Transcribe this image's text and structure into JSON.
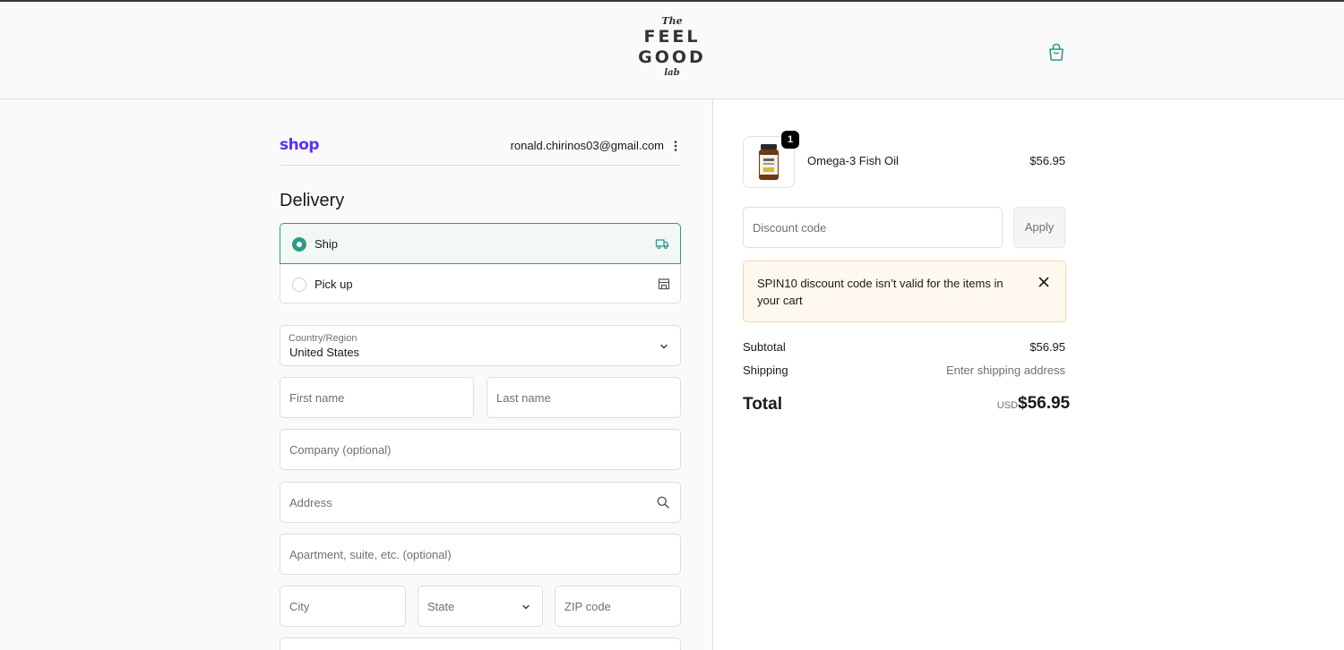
{
  "header": {
    "logo_the": "The",
    "logo_line1": "FEEL",
    "logo_line2": "GOOD",
    "logo_lab": "lab",
    "accent_color": "#2d9b87"
  },
  "account": {
    "shop_brand": "shop",
    "email": "ronald.chirinos03@gmail.com"
  },
  "delivery": {
    "title": "Delivery",
    "options": [
      {
        "label": "Ship",
        "selected": true,
        "icon": "truck-icon"
      },
      {
        "label": "Pick up",
        "selected": false,
        "icon": "store-icon"
      }
    ]
  },
  "form": {
    "country_label": "Country/Region",
    "country_value": "United States",
    "first_name_placeholder": "First name",
    "last_name_placeholder": "Last name",
    "company_placeholder": "Company (optional)",
    "address_placeholder": "Address",
    "apartment_placeholder": "Apartment, suite, etc. (optional)",
    "city_placeholder": "City",
    "state_placeholder": "State",
    "zip_placeholder": "ZIP code"
  },
  "cart": {
    "items": [
      {
        "name": "Omega-3 Fish Oil",
        "price": "$56.95",
        "quantity": "1"
      }
    ],
    "discount_placeholder": "Discount code",
    "apply_label": "Apply",
    "alert_message": "SPIN10 discount code isn’t valid for the items in your cart",
    "subtotal_label": "Subtotal",
    "subtotal_value": "$56.95",
    "shipping_label": "Shipping",
    "shipping_value": "Enter shipping address",
    "total_label": "Total",
    "total_currency": "USD",
    "total_value": "$56.95"
  }
}
